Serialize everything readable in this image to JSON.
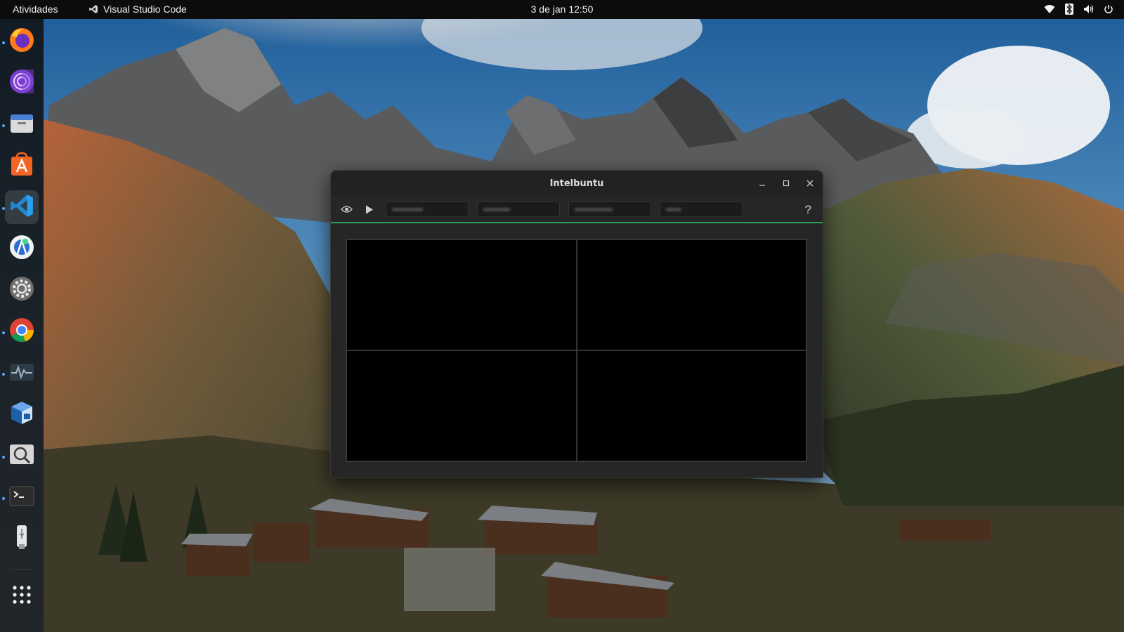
{
  "topbar": {
    "activities": "Atividades",
    "focused_app": "Visual Studio Code",
    "focused_app_icon": "vscode-icon",
    "clock": "3 de jan  12:50",
    "tray_icons": [
      "wifi-icon",
      "bluetooth-icon",
      "volume-icon",
      "power-icon"
    ]
  },
  "dock": {
    "items": [
      {
        "icon": "firefox-icon",
        "running": true
      },
      {
        "icon": "tor-browser-icon",
        "running": false
      },
      {
        "icon": "files-icon",
        "running": true
      },
      {
        "icon": "app-center-icon",
        "running": false
      },
      {
        "icon": "vscode-icon",
        "running": true,
        "active": true
      },
      {
        "icon": "android-studio-icon",
        "running": false
      },
      {
        "icon": "settings-icon",
        "running": false
      },
      {
        "icon": "chrome-icon",
        "running": true
      },
      {
        "icon": "system-monitor-icon",
        "running": true
      },
      {
        "icon": "virtualbox-icon",
        "running": false
      },
      {
        "icon": "image-viewer-icon",
        "running": true
      },
      {
        "icon": "terminal-icon",
        "running": true
      },
      {
        "icon": "usb-drive-icon",
        "running": false
      },
      {
        "icon": "show-apps-icon",
        "running": false
      }
    ]
  },
  "window": {
    "title": "Intelbuntu",
    "controls": [
      "minimize-icon",
      "maximize-icon",
      "close-icon"
    ],
    "toolbar": {
      "buttons": [
        "eye-icon",
        "play-icon"
      ],
      "help_label": "?"
    },
    "video_cells": 4
  },
  "colors": {
    "accent_line": "#2f9c53",
    "topbar_bg": "#0c0c0c",
    "window_bg": "#262626",
    "running_dot": "#58a6ff"
  }
}
